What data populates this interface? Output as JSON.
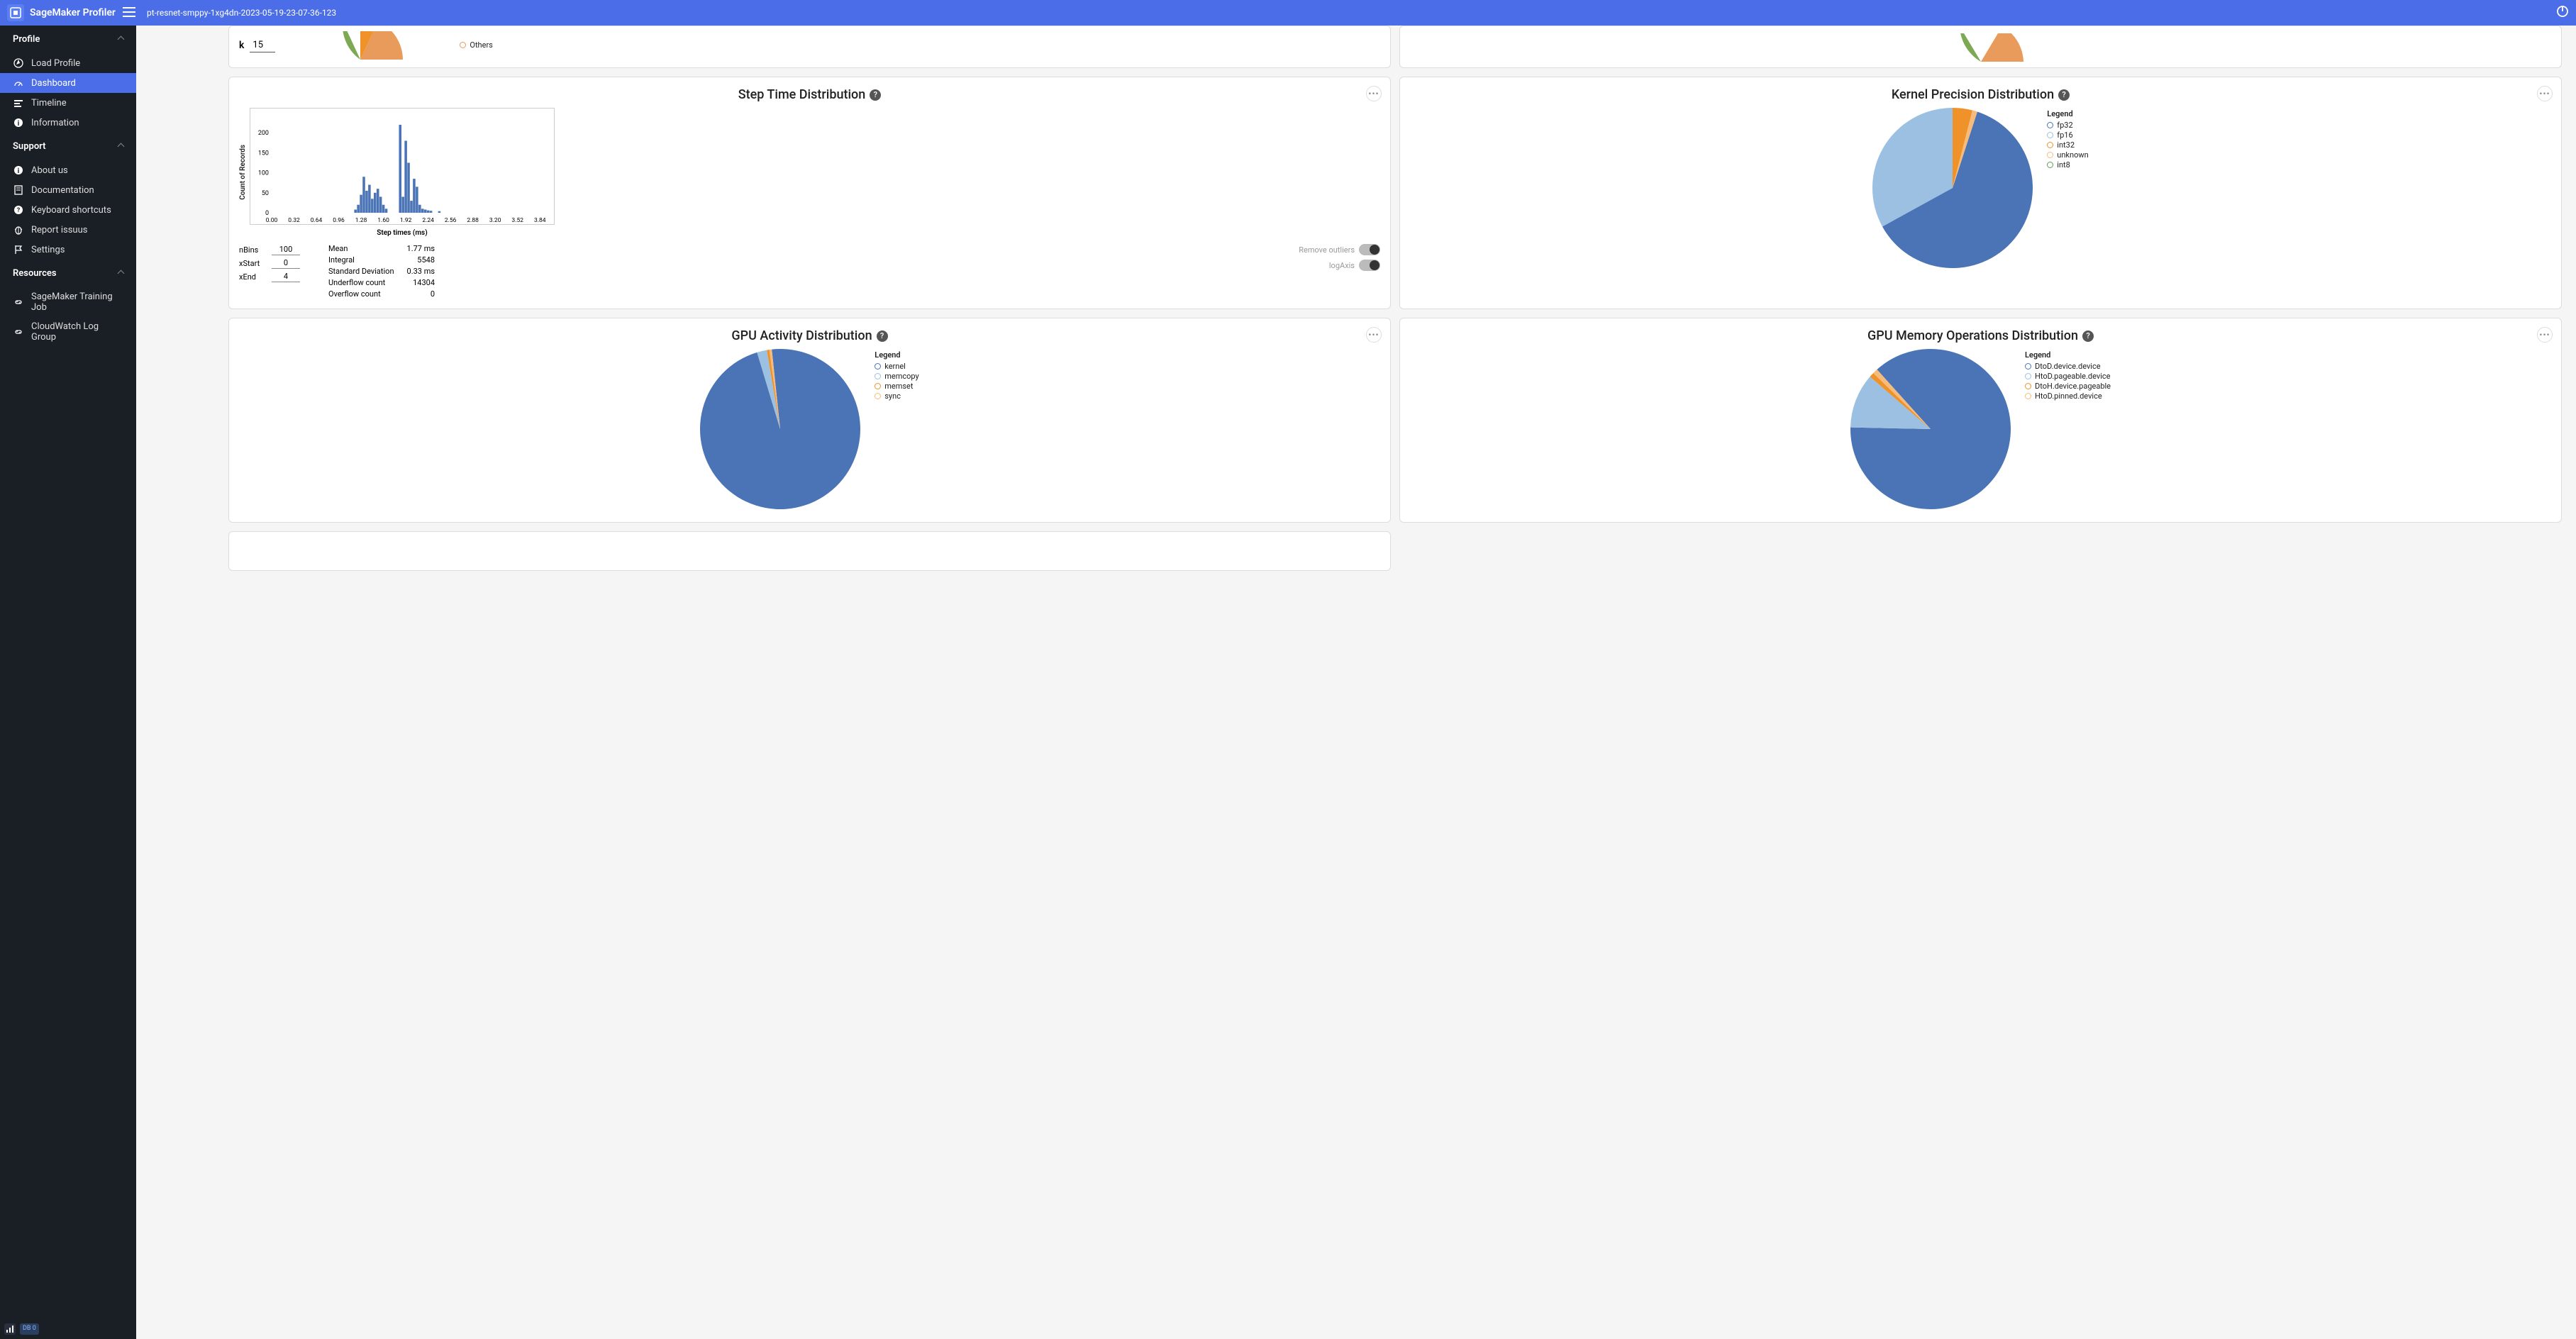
{
  "header": {
    "app_name": "SageMaker Profiler",
    "job_name": "pt-resnet-smppy-1xg4dn-2023-05-19-23-07-36-123"
  },
  "sidebar": {
    "sections": {
      "profile": {
        "label": "Profile"
      },
      "support": {
        "label": "Support"
      },
      "resources": {
        "label": "Resources"
      }
    },
    "items": {
      "load_profile": "Load Profile",
      "dashboard": "Dashboard",
      "timeline": "Timeline",
      "information": "Information",
      "about_us": "About us",
      "documentation": "Documentation",
      "keyboard_shortcuts": "Keyboard shortcuts",
      "report_issues": "Report issuus",
      "settings": "Settings",
      "training_job": "SageMaker Training Job",
      "log_group": "CloudWatch Log Group"
    },
    "footer_badge": "DB\n0"
  },
  "partial_card": {
    "k_label": "k",
    "k_value": "15",
    "legend_item": "Others",
    "legend_color": "#e89b5a"
  },
  "step_time": {
    "title": "Step Time Distribution",
    "ylabel": "Count of Records",
    "xlabel": "Step times (ms)",
    "controls": {
      "nbins_label": "nBins",
      "nbins_value": "100",
      "xstart_label": "xStart",
      "xstart_value": "0",
      "xend_label": "xEnd",
      "xend_value": "4"
    },
    "stats": {
      "mean_label": "Mean",
      "mean_value": "1.77 ms",
      "integral_label": "Integral",
      "integral_value": "5548",
      "stddev_label": "Standard Deviation",
      "stddev_value": "0.33 ms",
      "underflow_label": "Underflow count",
      "underflow_value": "14304",
      "overflow_label": "Overflow count",
      "overflow_value": "0"
    },
    "toggles": {
      "remove_outliers": "Remove outliers",
      "log_axis": "logAxis"
    }
  },
  "kernel_precision": {
    "title": "Kernel Precision Distribution",
    "legend_title": "Legend",
    "items": [
      {
        "label": "fp32",
        "color": "#4a74b5"
      },
      {
        "label": "fp16",
        "color": "#9bc0e2"
      },
      {
        "label": "int32",
        "color": "#f0922a"
      },
      {
        "label": "unknown",
        "color": "#f6bb7a"
      },
      {
        "label": "int8",
        "color": "#5e9e52"
      }
    ]
  },
  "gpu_activity": {
    "title": "GPU Activity Distribution",
    "legend_title": "Legend",
    "items": [
      {
        "label": "kernel",
        "color": "#4a74b5"
      },
      {
        "label": "memcopy",
        "color": "#9bc0e2"
      },
      {
        "label": "memset",
        "color": "#f0922a"
      },
      {
        "label": "sync",
        "color": "#f6bb7a"
      }
    ]
  },
  "gpu_memory": {
    "title": "GPU Memory Operations Distribution",
    "legend_title": "Legend",
    "items": [
      {
        "label": "DtoD.device.device",
        "color": "#4a74b5"
      },
      {
        "label": "HtoD.pageable.device",
        "color": "#9bc0e2"
      },
      {
        "label": "DtoH.device.pageable",
        "color": "#f0922a"
      },
      {
        "label": "HtoD.pinned.device",
        "color": "#f6bb7a"
      }
    ]
  },
  "chart_data": [
    {
      "type": "bar",
      "name": "Step Time Distribution",
      "xlabel": "Step times (ms)",
      "ylabel": "Count of Records",
      "xlim": [
        0,
        4
      ],
      "ylim": [
        0,
        250
      ],
      "xticks": [
        0.0,
        0.32,
        0.64,
        0.96,
        1.28,
        1.6,
        1.92,
        2.24,
        2.56,
        2.88,
        3.2,
        3.52,
        3.84
      ],
      "yticks": [
        0,
        50,
        100,
        150,
        200
      ],
      "x": [
        1.2,
        1.24,
        1.28,
        1.32,
        1.36,
        1.4,
        1.44,
        1.48,
        1.52,
        1.56,
        1.6,
        1.64,
        1.84,
        1.88,
        1.92,
        1.96,
        2.0,
        2.04,
        2.08,
        2.12,
        2.16,
        2.2,
        2.24,
        2.28,
        2.4
      ],
      "values": [
        8,
        20,
        45,
        90,
        55,
        70,
        35,
        50,
        60,
        40,
        20,
        10,
        220,
        40,
        180,
        125,
        30,
        85,
        65,
        20,
        10,
        8,
        6,
        5,
        4
      ]
    },
    {
      "type": "pie",
      "name": "Kernel Precision Distribution",
      "series": [
        {
          "name": "fp32",
          "value": 62,
          "color": "#4a74b5"
        },
        {
          "name": "fp16",
          "value": 33,
          "color": "#9bc0e2"
        },
        {
          "name": "int32",
          "value": 4,
          "color": "#f0922a"
        },
        {
          "name": "unknown",
          "value": 1,
          "color": "#f6bb7a"
        },
        {
          "name": "int8",
          "value": 0,
          "color": "#5e9e52"
        }
      ]
    },
    {
      "type": "pie",
      "name": "GPU Activity Distribution",
      "series": [
        {
          "name": "kernel",
          "value": 97,
          "color": "#4a74b5"
        },
        {
          "name": "memcopy",
          "value": 2,
          "color": "#9bc0e2"
        },
        {
          "name": "memset",
          "value": 0.5,
          "color": "#f0922a"
        },
        {
          "name": "sync",
          "value": 0.5,
          "color": "#f6bb7a"
        }
      ]
    },
    {
      "type": "pie",
      "name": "GPU Memory Operations Distribution",
      "series": [
        {
          "name": "DtoD.device.device",
          "value": 87,
          "color": "#4a74b5"
        },
        {
          "name": "HtoD.pageable.device",
          "value": 11,
          "color": "#9bc0e2"
        },
        {
          "name": "DtoH.device.pageable",
          "value": 1,
          "color": "#f0922a"
        },
        {
          "name": "HtoD.pinned.device",
          "value": 1,
          "color": "#f6bb7a"
        }
      ]
    }
  ]
}
